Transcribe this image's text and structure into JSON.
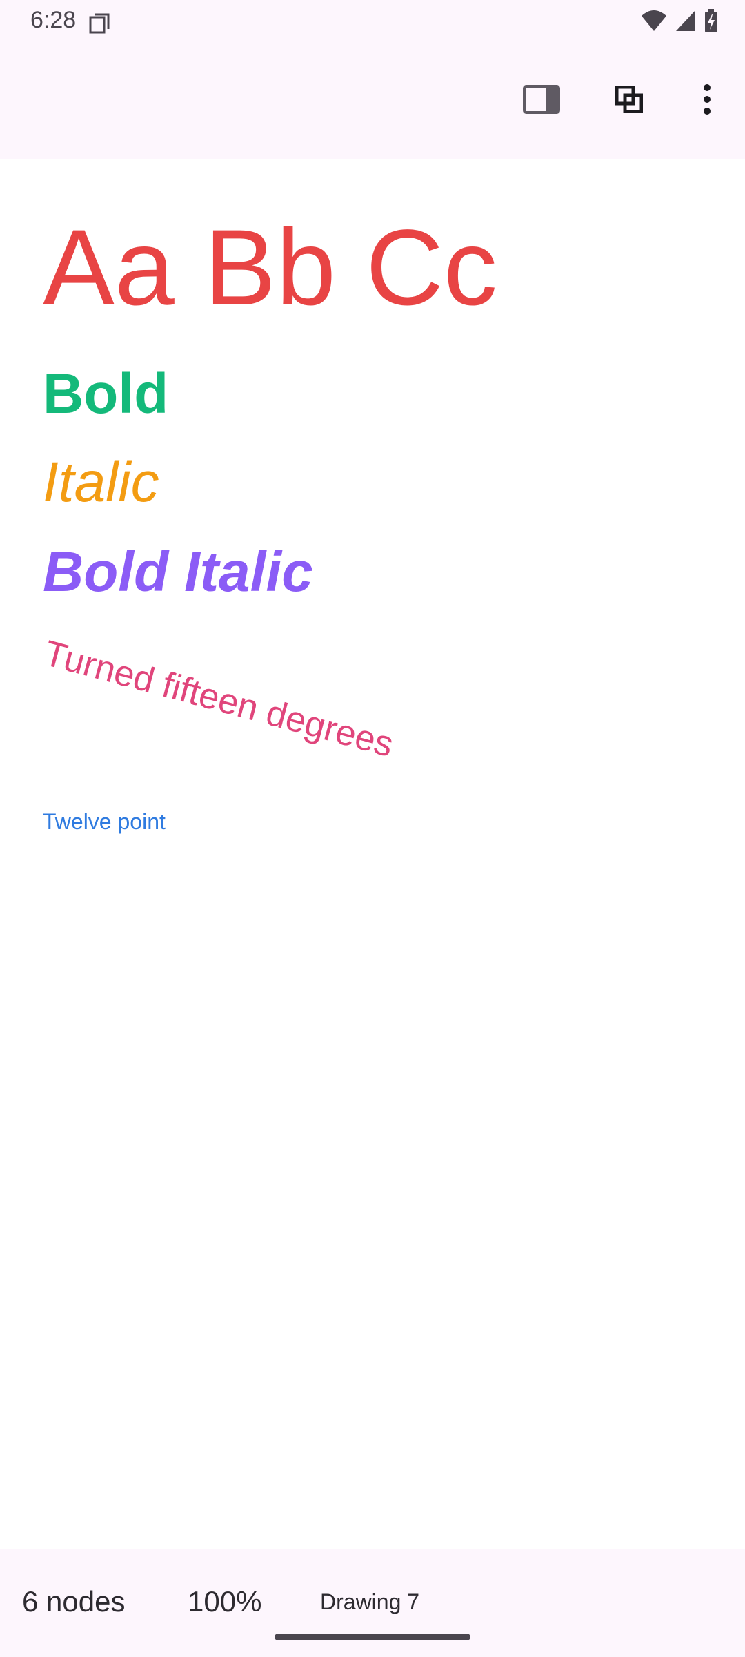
{
  "status_bar": {
    "time": "6:28",
    "icons": [
      "clipboard-icon",
      "wifi-icon",
      "signal-icon",
      "battery-charging-icon"
    ]
  },
  "toolbar": {
    "buttons": [
      "side-panel-icon",
      "layers-icon",
      "more-vert-icon"
    ]
  },
  "canvas": {
    "texts": [
      {
        "text": "Aa Bb Cc",
        "color": "#e84444"
      },
      {
        "text": "Bold",
        "color": "#14b97a"
      },
      {
        "text": "Italic",
        "color": "#f39c12"
      },
      {
        "text": "Bold Italic",
        "color": "#8b5cf6"
      },
      {
        "text": "Turned fifteen degrees",
        "color": "#e0457b"
      },
      {
        "text": "Twelve point",
        "color": "#2f7be0"
      }
    ]
  },
  "bottom_bar": {
    "nodes": "6 nodes",
    "zoom": "100%",
    "title": "Drawing 7"
  }
}
